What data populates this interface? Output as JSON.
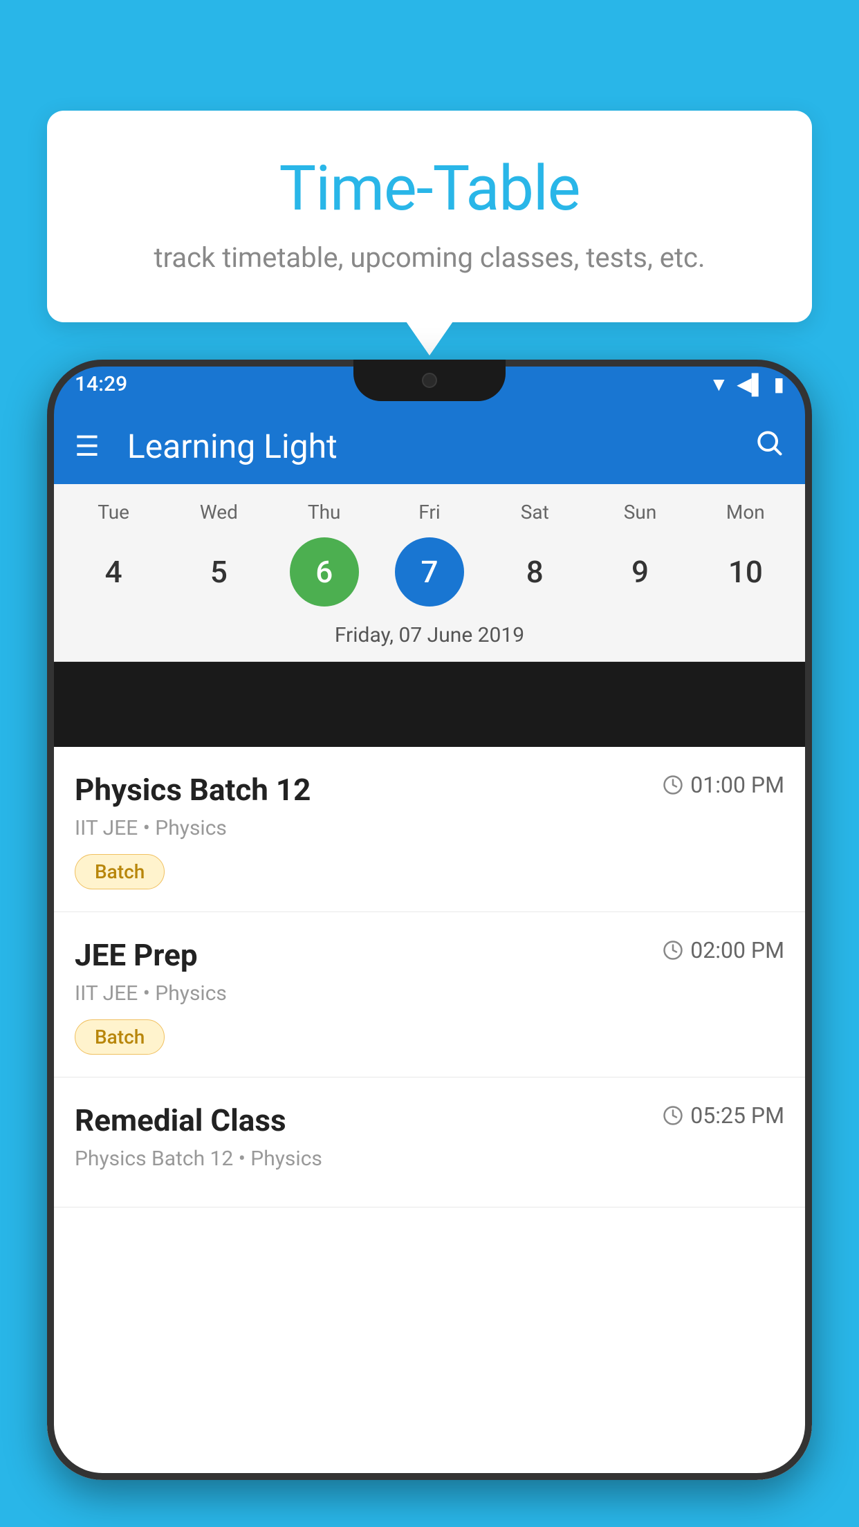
{
  "background_color": "#29b6e8",
  "tooltip": {
    "title": "Time-Table",
    "subtitle": "track timetable, upcoming classes, tests, etc."
  },
  "phone": {
    "status_bar": {
      "time": "14:29"
    },
    "app_bar": {
      "title": "Learning Light"
    },
    "calendar": {
      "days": [
        "Tue",
        "Wed",
        "Thu",
        "Fri",
        "Sat",
        "Sun",
        "Mon"
      ],
      "dates": [
        "4",
        "5",
        "6",
        "7",
        "8",
        "9",
        "10"
      ],
      "today_index": 2,
      "selected_index": 3,
      "selected_label": "Friday, 07 June 2019"
    },
    "schedule": [
      {
        "title": "Physics Batch 12",
        "time": "01:00 PM",
        "subtitle": "IIT JEE • Physics",
        "badge": "Batch"
      },
      {
        "title": "JEE Prep",
        "time": "02:00 PM",
        "subtitle": "IIT JEE • Physics",
        "badge": "Batch"
      },
      {
        "title": "Remedial Class",
        "time": "05:25 PM",
        "subtitle": "Physics Batch 12 • Physics",
        "badge": null
      }
    ]
  },
  "icons": {
    "hamburger": "☰",
    "search": "🔍",
    "clock": "⏰"
  }
}
